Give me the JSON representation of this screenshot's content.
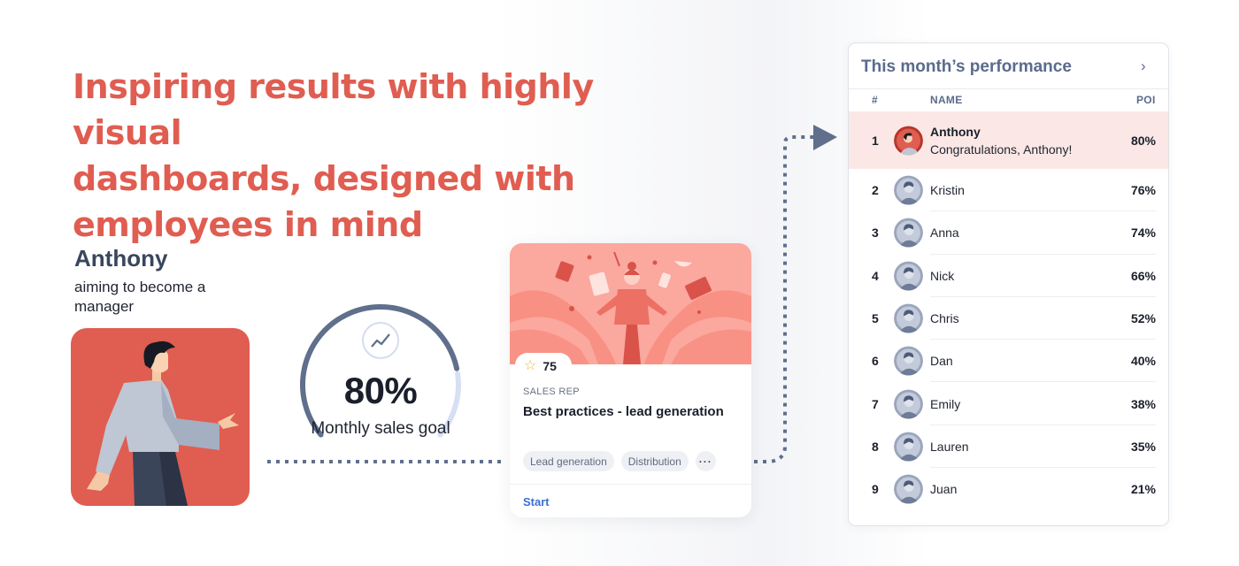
{
  "headline": {
    "lines": [
      "Inspiring results with highly visual",
      "dashboards, designed with",
      "employees in mind"
    ]
  },
  "persona": {
    "name": "Anthony",
    "subtitle": "aiming to become a manager",
    "illustration": "walking-person-illustration"
  },
  "gauge": {
    "value_label": "80%",
    "progress": 0.8,
    "label": "Monthly sales goal",
    "icon": "trend-up-icon",
    "colors": {
      "filled": "#5f6f8c",
      "track": "#d7e0f3"
    }
  },
  "course": {
    "rating": "75",
    "rating_icon": "star-icon",
    "category": "SALES REP",
    "title": "Best practices - lead generation",
    "tags": [
      "Lead generation",
      "Distribution"
    ],
    "more_label": "···",
    "start_label": "Start",
    "illustration": "juggling-tasks-illustration"
  },
  "performance": {
    "title": "This month’s performance",
    "chevron": "chevron-right-icon",
    "columns": {
      "rank": "#",
      "name": "NAME",
      "points": "POI"
    },
    "leader": {
      "rank": "1",
      "name": "Anthony",
      "message": "Congratulations, Anthony!",
      "percent": "80%"
    },
    "rows": [
      {
        "rank": "2",
        "name": "Kristin",
        "percent": "76%"
      },
      {
        "rank": "3",
        "name": "Anna",
        "percent": "74%"
      },
      {
        "rank": "4",
        "name": "Nick",
        "percent": "66%"
      },
      {
        "rank": "5",
        "name": "Chris",
        "percent": "52%"
      },
      {
        "rank": "6",
        "name": "Dan",
        "percent": "40%"
      },
      {
        "rank": "7",
        "name": "Emily",
        "percent": "38%"
      },
      {
        "rank": "8",
        "name": "Lauren",
        "percent": "35%"
      },
      {
        "rank": "9",
        "name": "Juan",
        "percent": "21%"
      }
    ]
  },
  "colors": {
    "accent": "#e05d51",
    "slate": "#5a6b8c",
    "highlight_row": "#fbe8e6",
    "link": "#3b6fd6"
  }
}
